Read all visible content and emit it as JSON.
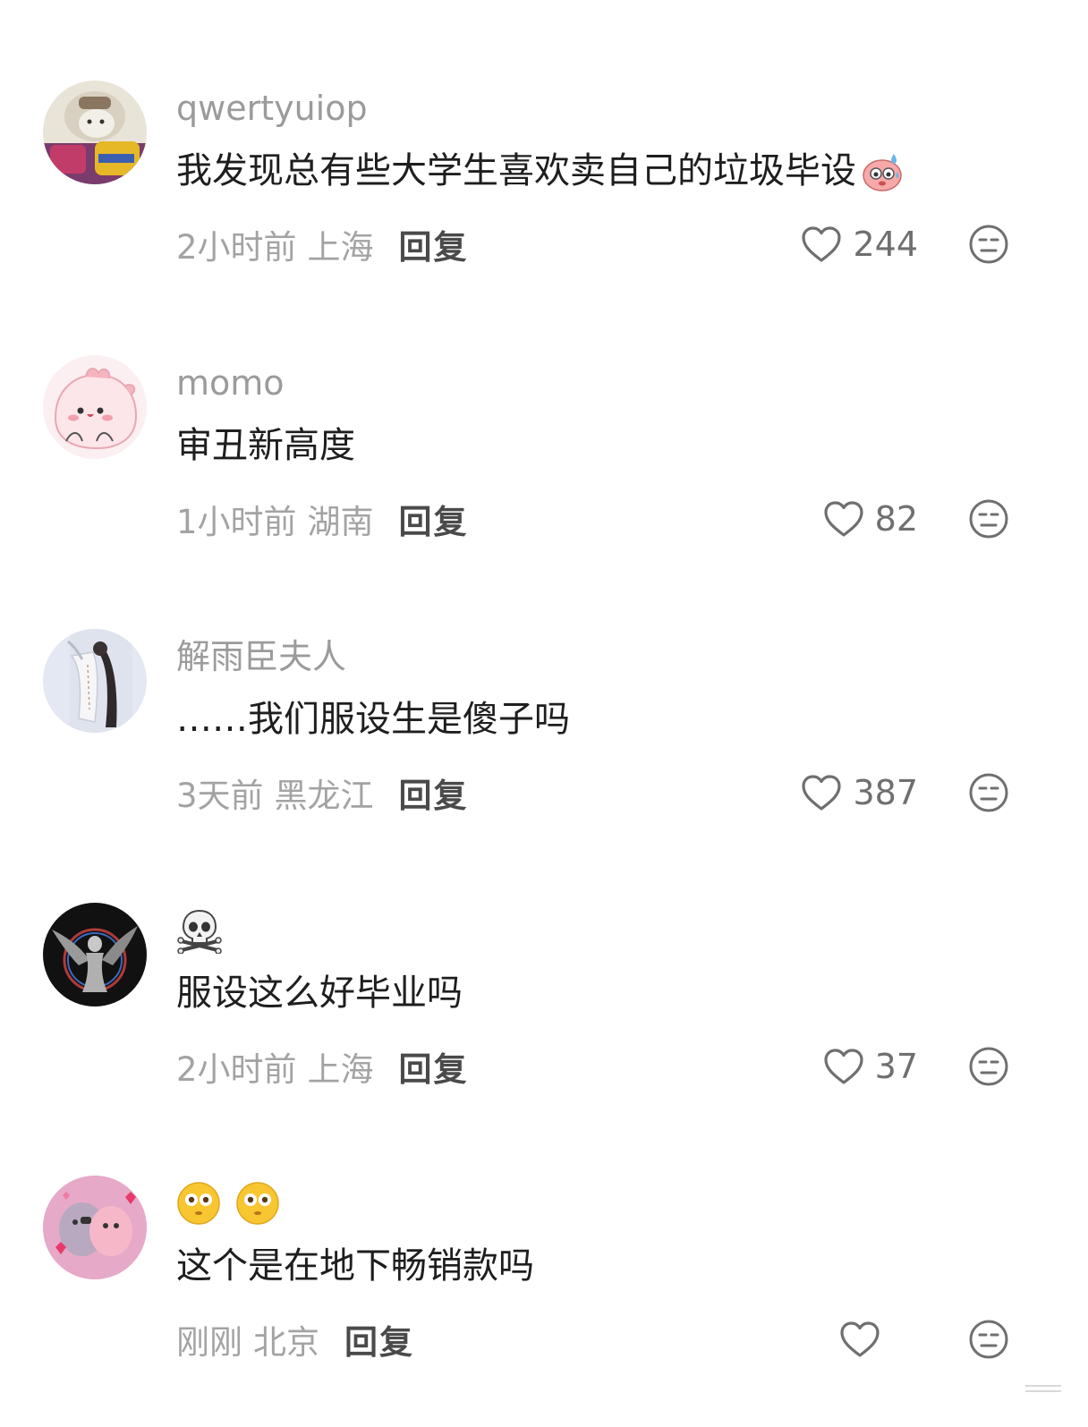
{
  "comments": [
    {
      "username": "qwertyuiop",
      "text": "我发现总有些大学生喜欢卖自己的垃圾毕设",
      "time": "2小时前",
      "location": "上海",
      "reply_label": "回复",
      "likes": "244"
    },
    {
      "username": "momo",
      "text": "审丑新高度",
      "time": "1小时前",
      "location": "湖南",
      "reply_label": "回复",
      "likes": "82"
    },
    {
      "username": "解雨臣夫人",
      "text": "……我们服设生是傻子吗",
      "time": "3天前",
      "location": "黑龙江",
      "reply_label": "回复",
      "likes": "387"
    },
    {
      "username": "☠️",
      "text": "服设这么好毕业吗",
      "time": "2小时前",
      "location": "上海",
      "reply_label": "回复",
      "likes": "37"
    },
    {
      "username": "😳😳",
      "text": "这个是在地下畅销款吗",
      "time": "刚刚",
      "location": "北京",
      "reply_label": "回复",
      "likes": ""
    }
  ],
  "icons": {
    "like": "heart-outline-icon",
    "dislike": "unamused-face-icon",
    "emoji_in_comment_1": "sweating-face-sticker"
  },
  "colors": {
    "username": "#9b9b9b",
    "text": "#1e1e1e",
    "meta": "#a3a3a3",
    "reply": "#4a4a4a",
    "icon": "#6f6f6f"
  }
}
